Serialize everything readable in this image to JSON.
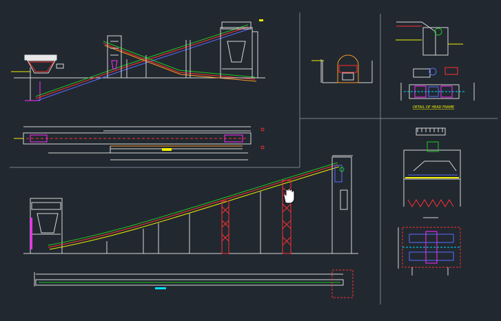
{
  "drawing": {
    "background": "#212830",
    "colors": {
      "outline": "#d9d9d9",
      "red": "#ff3030",
      "green": "#21c821",
      "yellow": "#f2f200",
      "magenta": "#ff2cff",
      "cyan": "#00e0ff",
      "blue": "#5a6cff",
      "orange": "#ff9a20",
      "divider": "#7a828c"
    },
    "labels": {
      "head_frame_title": "DETAIL OF HEAD FRAME"
    },
    "cursor_icon": "hand-pan-icon"
  }
}
